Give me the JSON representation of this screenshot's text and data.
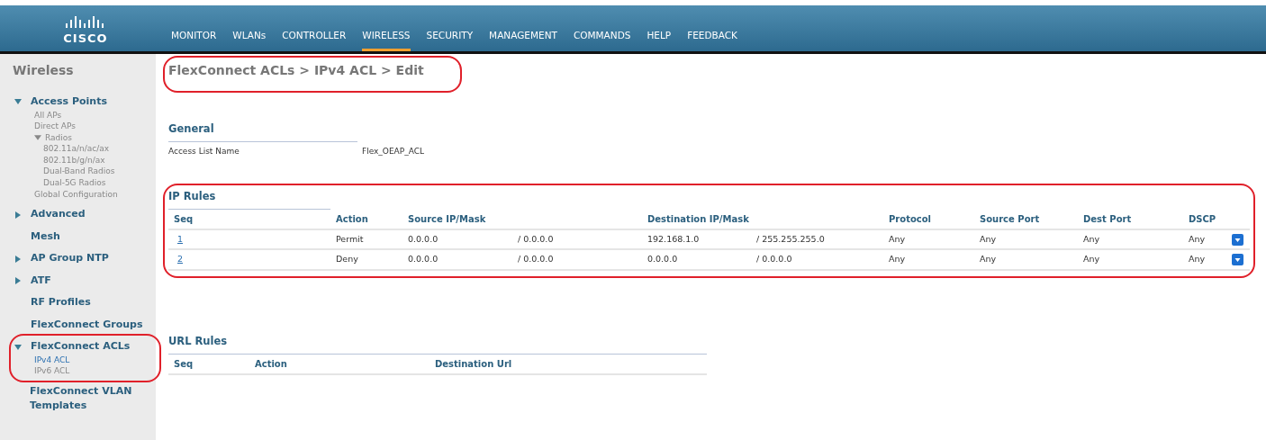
{
  "header": {
    "logo": "CISCO",
    "menu": [
      {
        "label": "MONITOR",
        "selected": false
      },
      {
        "label": "WLANs",
        "selected": false
      },
      {
        "label": "CONTROLLER",
        "selected": false
      },
      {
        "label": "WIRELESS",
        "selected": true
      },
      {
        "label": "SECURITY",
        "selected": false
      },
      {
        "label": "MANAGEMENT",
        "selected": false
      },
      {
        "label": "COMMANDS",
        "selected": false
      },
      {
        "label": "HELP",
        "selected": false
      },
      {
        "label": "FEEDBACK",
        "selected": false
      }
    ]
  },
  "sidebar": {
    "title": "Wireless",
    "items": [
      {
        "label": "Access Points",
        "expanded": true,
        "highlighted": false,
        "children": [
          {
            "label": "All APs",
            "selected": false
          },
          {
            "label": "Direct APs",
            "selected": false
          },
          {
            "label": "Radios",
            "expanded": true,
            "selected": false,
            "children": [
              {
                "label": "802.11a/n/ac/ax",
                "selected": false
              },
              {
                "label": "802.11b/g/n/ax",
                "selected": false
              },
              {
                "label": "Dual-Band Radios",
                "selected": false
              },
              {
                "label": "Dual-5G Radios",
                "selected": false
              }
            ]
          },
          {
            "label": "Global Configuration",
            "selected": false
          }
        ]
      },
      {
        "label": "Advanced",
        "expanded": false,
        "highlighted": false
      },
      {
        "label": "Mesh",
        "highlighted": false
      },
      {
        "label": "AP Group NTP",
        "expanded": false,
        "highlighted": false
      },
      {
        "label": "ATF",
        "expanded": false,
        "highlighted": false
      },
      {
        "label": "RF Profiles",
        "highlighted": false
      },
      {
        "label": "FlexConnect Groups",
        "highlighted": false
      },
      {
        "label": "FlexConnect ACLs",
        "expanded": true,
        "highlighted": true,
        "children": [
          {
            "label": "IPv4 ACL",
            "selected": true
          },
          {
            "label": "IPv6 ACL",
            "selected": false
          }
        ]
      },
      {
        "label": "FlexConnect VLAN Templates",
        "highlighted": false
      }
    ]
  },
  "breadcrumb": {
    "text": "FlexConnect ACLs > IPv4 ACL > Edit",
    "highlighted": true
  },
  "general": {
    "title": "General",
    "label": "Access List Name",
    "value": "Flex_OEAP_ACL"
  },
  "ip_rules": {
    "title": "IP Rules",
    "highlighted": true,
    "columns": [
      "Seq",
      "Action",
      "Source IP/Mask",
      "Destination IP/Mask",
      "Protocol",
      "Source Port",
      "Dest Port",
      "DSCP"
    ],
    "rows": [
      {
        "seq": "1",
        "action": "Permit",
        "source_ip": "0.0.0.0",
        "source_mask": "/ 0.0.0.0",
        "dest_ip": "192.168.1.0",
        "dest_mask": "/ 255.255.255.0",
        "protocol": "Any",
        "source_port": "Any",
        "dest_port": "Any",
        "dscp": "Any"
      },
      {
        "seq": "2",
        "action": "Deny",
        "source_ip": "0.0.0.0",
        "source_mask": "/ 0.0.0.0",
        "dest_ip": "0.0.0.0",
        "dest_mask": "/ 0.0.0.0",
        "protocol": "Any",
        "source_port": "Any",
        "dest_port": "Any",
        "dscp": "Any"
      }
    ]
  },
  "url_rules": {
    "title": "URL Rules",
    "columns": [
      "Seq",
      "Action",
      "Destination Url"
    ]
  }
}
